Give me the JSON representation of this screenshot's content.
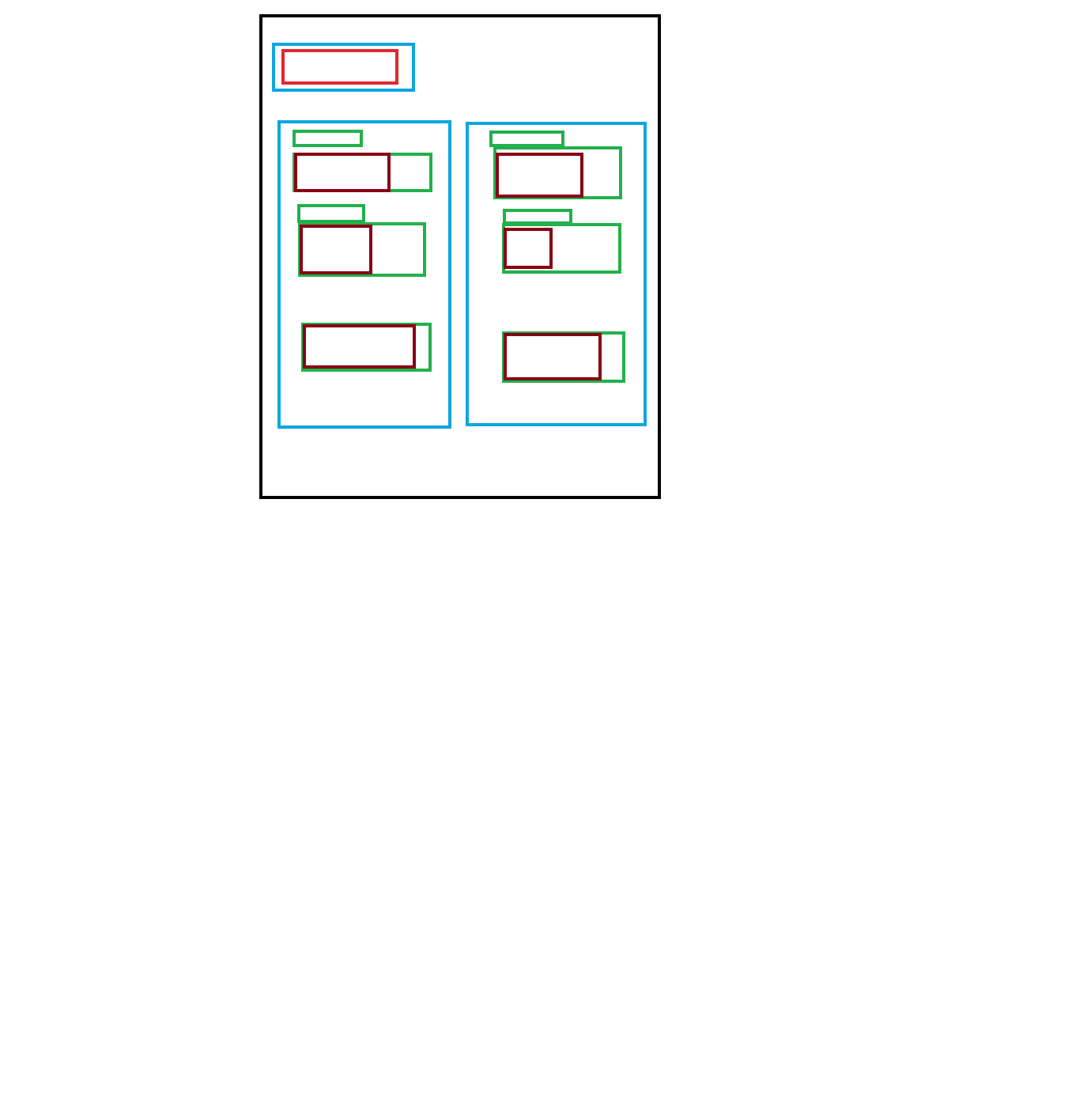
{
  "colors": {
    "frame": "#000000",
    "section": "#0ea5e0",
    "header_field": "#e3262d",
    "field_group": "#22b14c",
    "field": "#880015",
    "background": "#ffffff"
  },
  "diagram": {
    "header": {},
    "panels": [
      {
        "id": "left",
        "groups": [
          {
            "has_label": true
          },
          {
            "has_label": true
          },
          {
            "has_label": false
          }
        ]
      },
      {
        "id": "right",
        "groups": [
          {
            "has_label": true
          },
          {
            "has_label": true
          },
          {
            "has_label": false
          }
        ]
      }
    ]
  }
}
